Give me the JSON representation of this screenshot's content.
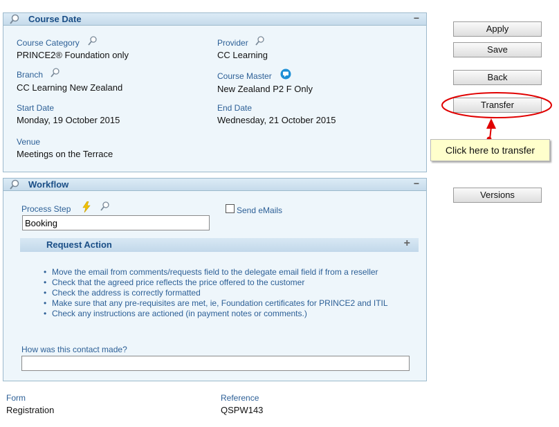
{
  "course_date": {
    "title": "Course Date",
    "course_category_label": "Course Category",
    "course_category_value": "PRINCE2® Foundation only",
    "provider_label": "Provider",
    "provider_value": "CC Learning",
    "branch_label": "Branch",
    "branch_value": "CC Learning New Zealand",
    "course_master_label": "Course Master",
    "course_master_value": "New Zealand P2 F Only",
    "start_date_label": "Start Date",
    "start_date_value": "Monday, 19 October 2015",
    "end_date_label": "End Date",
    "end_date_value": "Wednesday, 21 October 2015",
    "venue_label": "Venue",
    "venue_value": "Meetings on the Terrace",
    "collapse_symbol": "−"
  },
  "workflow": {
    "title": "Workflow",
    "process_step_label": "Process Step",
    "process_step_value": "Booking",
    "send_emails_label": "Send eMails",
    "send_emails_checked": false,
    "collapse_symbol": "−",
    "request_action": {
      "title": "Request Action",
      "expand_symbol": "+",
      "items": [
        "Move the email from comments/requests field to the delegate email field if from a reseller",
        "Check that the agreed price reflects the price offered to the customer",
        "Check the address is correctly formatted",
        "Make sure that any pre-requisites are met, ie, Foundation certificates for PRINCE2 and ITIL",
        "Check any instructions are actioned (in payment notes or comments.)"
      ]
    },
    "contact_label": "How was this contact made?",
    "contact_value": ""
  },
  "footer": {
    "form_label": "Form",
    "form_value": "Registration",
    "reference_label": "Reference",
    "reference_value": "QSPW143"
  },
  "buttons": {
    "apply": "Apply",
    "save": "Save",
    "back": "Back",
    "transfer": "Transfer",
    "versions": "Versions"
  },
  "callout": {
    "text": "Click here to transfer"
  },
  "colors": {
    "panel_bg": "#eef6fb",
    "header_text": "#1a4e86",
    "label_text": "#2c5f96",
    "annotation_red": "#e00000",
    "callout_bg": "#ffffcc"
  },
  "icons": [
    "magnifier-icon",
    "lightning-icon",
    "chat-bubble-icon",
    "collapse-icon",
    "expand-icon"
  ]
}
